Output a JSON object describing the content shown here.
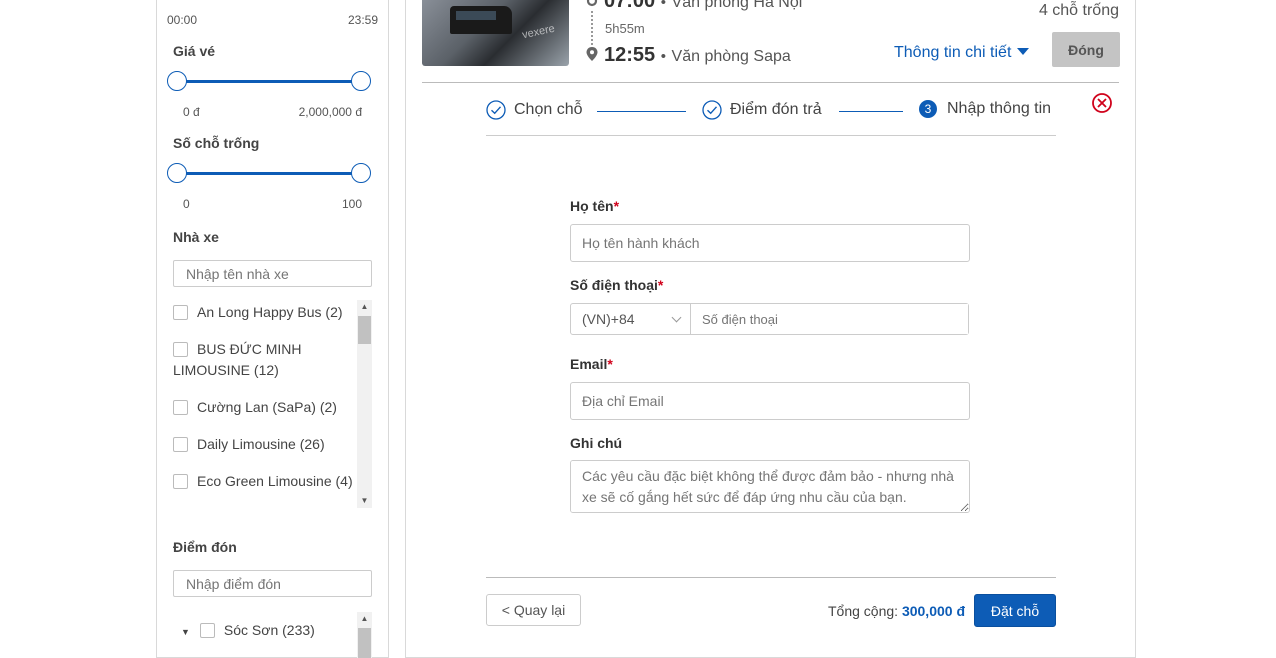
{
  "sidebar": {
    "time_range": {
      "min": "00:00",
      "max": "23:59"
    },
    "price": {
      "label": "Giá vé",
      "min": "0 đ",
      "max": "2,000,000 đ"
    },
    "seats": {
      "label": "Số chỗ trống",
      "min": "0",
      "max": "100"
    },
    "operator": {
      "label": "Nhà xe",
      "placeholder": "Nhập tên nhà xe",
      "items": [
        {
          "label": "An Long Happy Bus (2)"
        },
        {
          "label": "BUS ĐỨC MINH LIMOUSINE (12)"
        },
        {
          "label": "Cường Lan (SaPa) (2)"
        },
        {
          "label": "Daily Limousine (26)"
        },
        {
          "label": "Eco Green Limousine (4)"
        }
      ]
    },
    "pickup": {
      "label": "Điểm đón",
      "placeholder": "Nhập điểm đón",
      "items": [
        {
          "label": "Sóc Sơn (233)"
        }
      ]
    }
  },
  "trip": {
    "image_watermark": "vexere",
    "departure_time": "07:00",
    "departure_place": "Văn phòng Hà Nội",
    "duration": "5h55m",
    "arrival_time": "12:55",
    "arrival_place": "Văn phòng Sapa",
    "separator": "•",
    "seats_left": "4 chỗ trống",
    "detail_link": "Thông tin chi tiết",
    "close_button": "Đóng"
  },
  "stepper": {
    "steps": [
      {
        "label": "Chọn chỗ",
        "state": "done"
      },
      {
        "label": "Điểm đón trả",
        "state": "done"
      },
      {
        "label": "Nhập thông tin",
        "state": "active",
        "number": "3"
      }
    ]
  },
  "form": {
    "name": {
      "label": "Họ tên",
      "required": "*",
      "placeholder": "Họ tên hành khách"
    },
    "phone": {
      "label": "Số điện thoại",
      "required": "*",
      "country_code": "(VN)+84",
      "placeholder": "Số điện thoại"
    },
    "email": {
      "label": "Email",
      "required": "*",
      "placeholder": "Địa chỉ Email"
    },
    "note": {
      "label": "Ghi chú",
      "placeholder": "Các yêu cầu đặc biệt không thể được đảm bảo - nhưng nhà xe sẽ cố gắng hết sức để đáp ứng nhu cầu của bạn."
    }
  },
  "footer": {
    "back_button": "< Quay lại",
    "total_label": "Tổng cộng:",
    "total_amount": "300,000 đ",
    "book_button": "Đặt chỗ"
  },
  "colors": {
    "accent": "#0d5cb6",
    "danger": "#d0021b",
    "disabled": "#c4c4c4"
  }
}
